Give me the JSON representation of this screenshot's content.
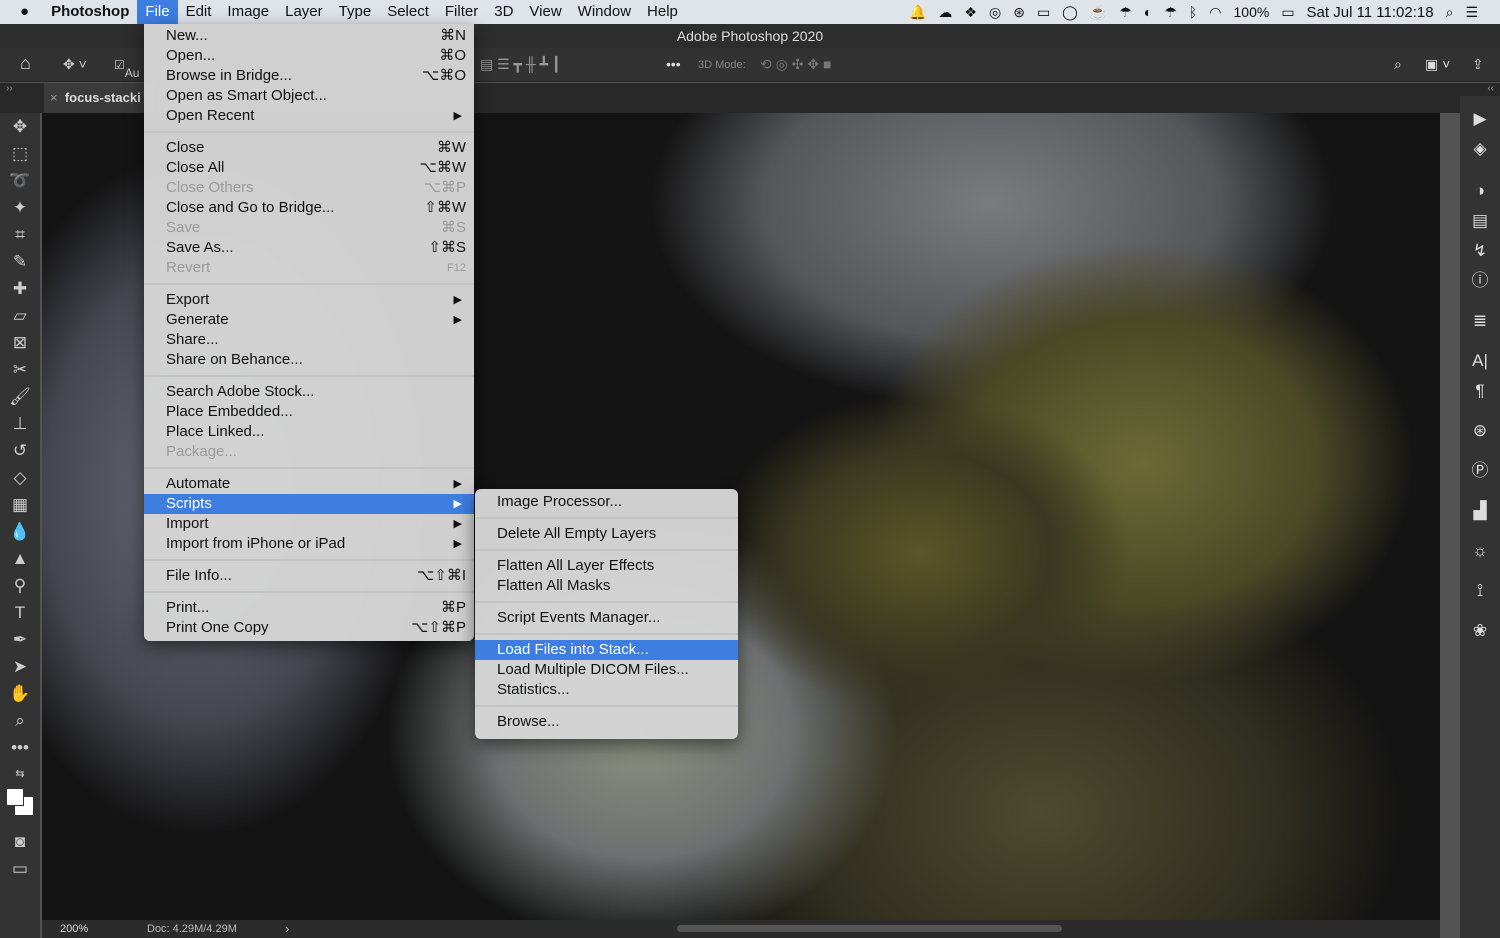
{
  "menubar": {
    "apple": "",
    "app": "Photoshop",
    "items": [
      "File",
      "Edit",
      "Image",
      "Layer",
      "Type",
      "Select",
      "Filter",
      "3D",
      "View",
      "Window",
      "Help"
    ],
    "battery": "100%",
    "clock": "Sat Jul 11  11:02:18"
  },
  "window_title": "Adobe Photoshop 2020",
  "options": {
    "auto_label": "Au",
    "mode_label": "3D Mode:"
  },
  "doc_tab": "focus-stacki",
  "file_menu": [
    {
      "label": "New...",
      "shortcut": "⌘N"
    },
    {
      "label": "Open...",
      "shortcut": "⌘O"
    },
    {
      "label": "Browse in Bridge...",
      "shortcut": "⌥⌘O"
    },
    {
      "label": "Open as Smart Object..."
    },
    {
      "label": "Open Recent",
      "submenu": true
    },
    {
      "sep": true
    },
    {
      "label": "Close",
      "shortcut": "⌘W"
    },
    {
      "label": "Close All",
      "shortcut": "⌥⌘W"
    },
    {
      "label": "Close Others",
      "shortcut": "⌥⌘P",
      "disabled": true
    },
    {
      "label": "Close and Go to Bridge...",
      "shortcut": "⇧⌘W"
    },
    {
      "label": "Save",
      "shortcut": "⌘S",
      "disabled": true
    },
    {
      "label": "Save As...",
      "shortcut": "⇧⌘S"
    },
    {
      "label": "Revert",
      "shortcut": "F12",
      "disabled": true
    },
    {
      "sep": true
    },
    {
      "label": "Export",
      "submenu": true
    },
    {
      "label": "Generate",
      "submenu": true
    },
    {
      "label": "Share..."
    },
    {
      "label": "Share on Behance..."
    },
    {
      "sep": true
    },
    {
      "label": "Search Adobe Stock..."
    },
    {
      "label": "Place Embedded..."
    },
    {
      "label": "Place Linked..."
    },
    {
      "label": "Package...",
      "disabled": true
    },
    {
      "sep": true
    },
    {
      "label": "Automate",
      "submenu": true
    },
    {
      "label": "Scripts",
      "submenu": true,
      "highlighted": true
    },
    {
      "label": "Import",
      "submenu": true
    },
    {
      "label": "Import from iPhone or iPad",
      "submenu": true
    },
    {
      "sep": true
    },
    {
      "label": "File Info...",
      "shortcut": "⌥⇧⌘I"
    },
    {
      "sep": true
    },
    {
      "label": "Print...",
      "shortcut": "⌘P"
    },
    {
      "label": "Print One Copy",
      "shortcut": "⌥⇧⌘P"
    }
  ],
  "scripts_menu": [
    {
      "label": "Image Processor..."
    },
    {
      "sep": true
    },
    {
      "label": "Delete All Empty Layers"
    },
    {
      "sep": true
    },
    {
      "label": "Flatten All Layer Effects"
    },
    {
      "label": "Flatten All Masks"
    },
    {
      "sep": true
    },
    {
      "label": "Script Events Manager..."
    },
    {
      "sep": true
    },
    {
      "label": "Load Files into Stack...",
      "highlighted": true
    },
    {
      "label": "Load Multiple DICOM Files..."
    },
    {
      "label": "Statistics..."
    },
    {
      "sep": true
    },
    {
      "label": "Browse..."
    }
  ],
  "status": {
    "zoom": "200%",
    "doc": "Doc: 4.29M/4.29M",
    "arrow": "›"
  },
  "accent": "#3d7ee0"
}
